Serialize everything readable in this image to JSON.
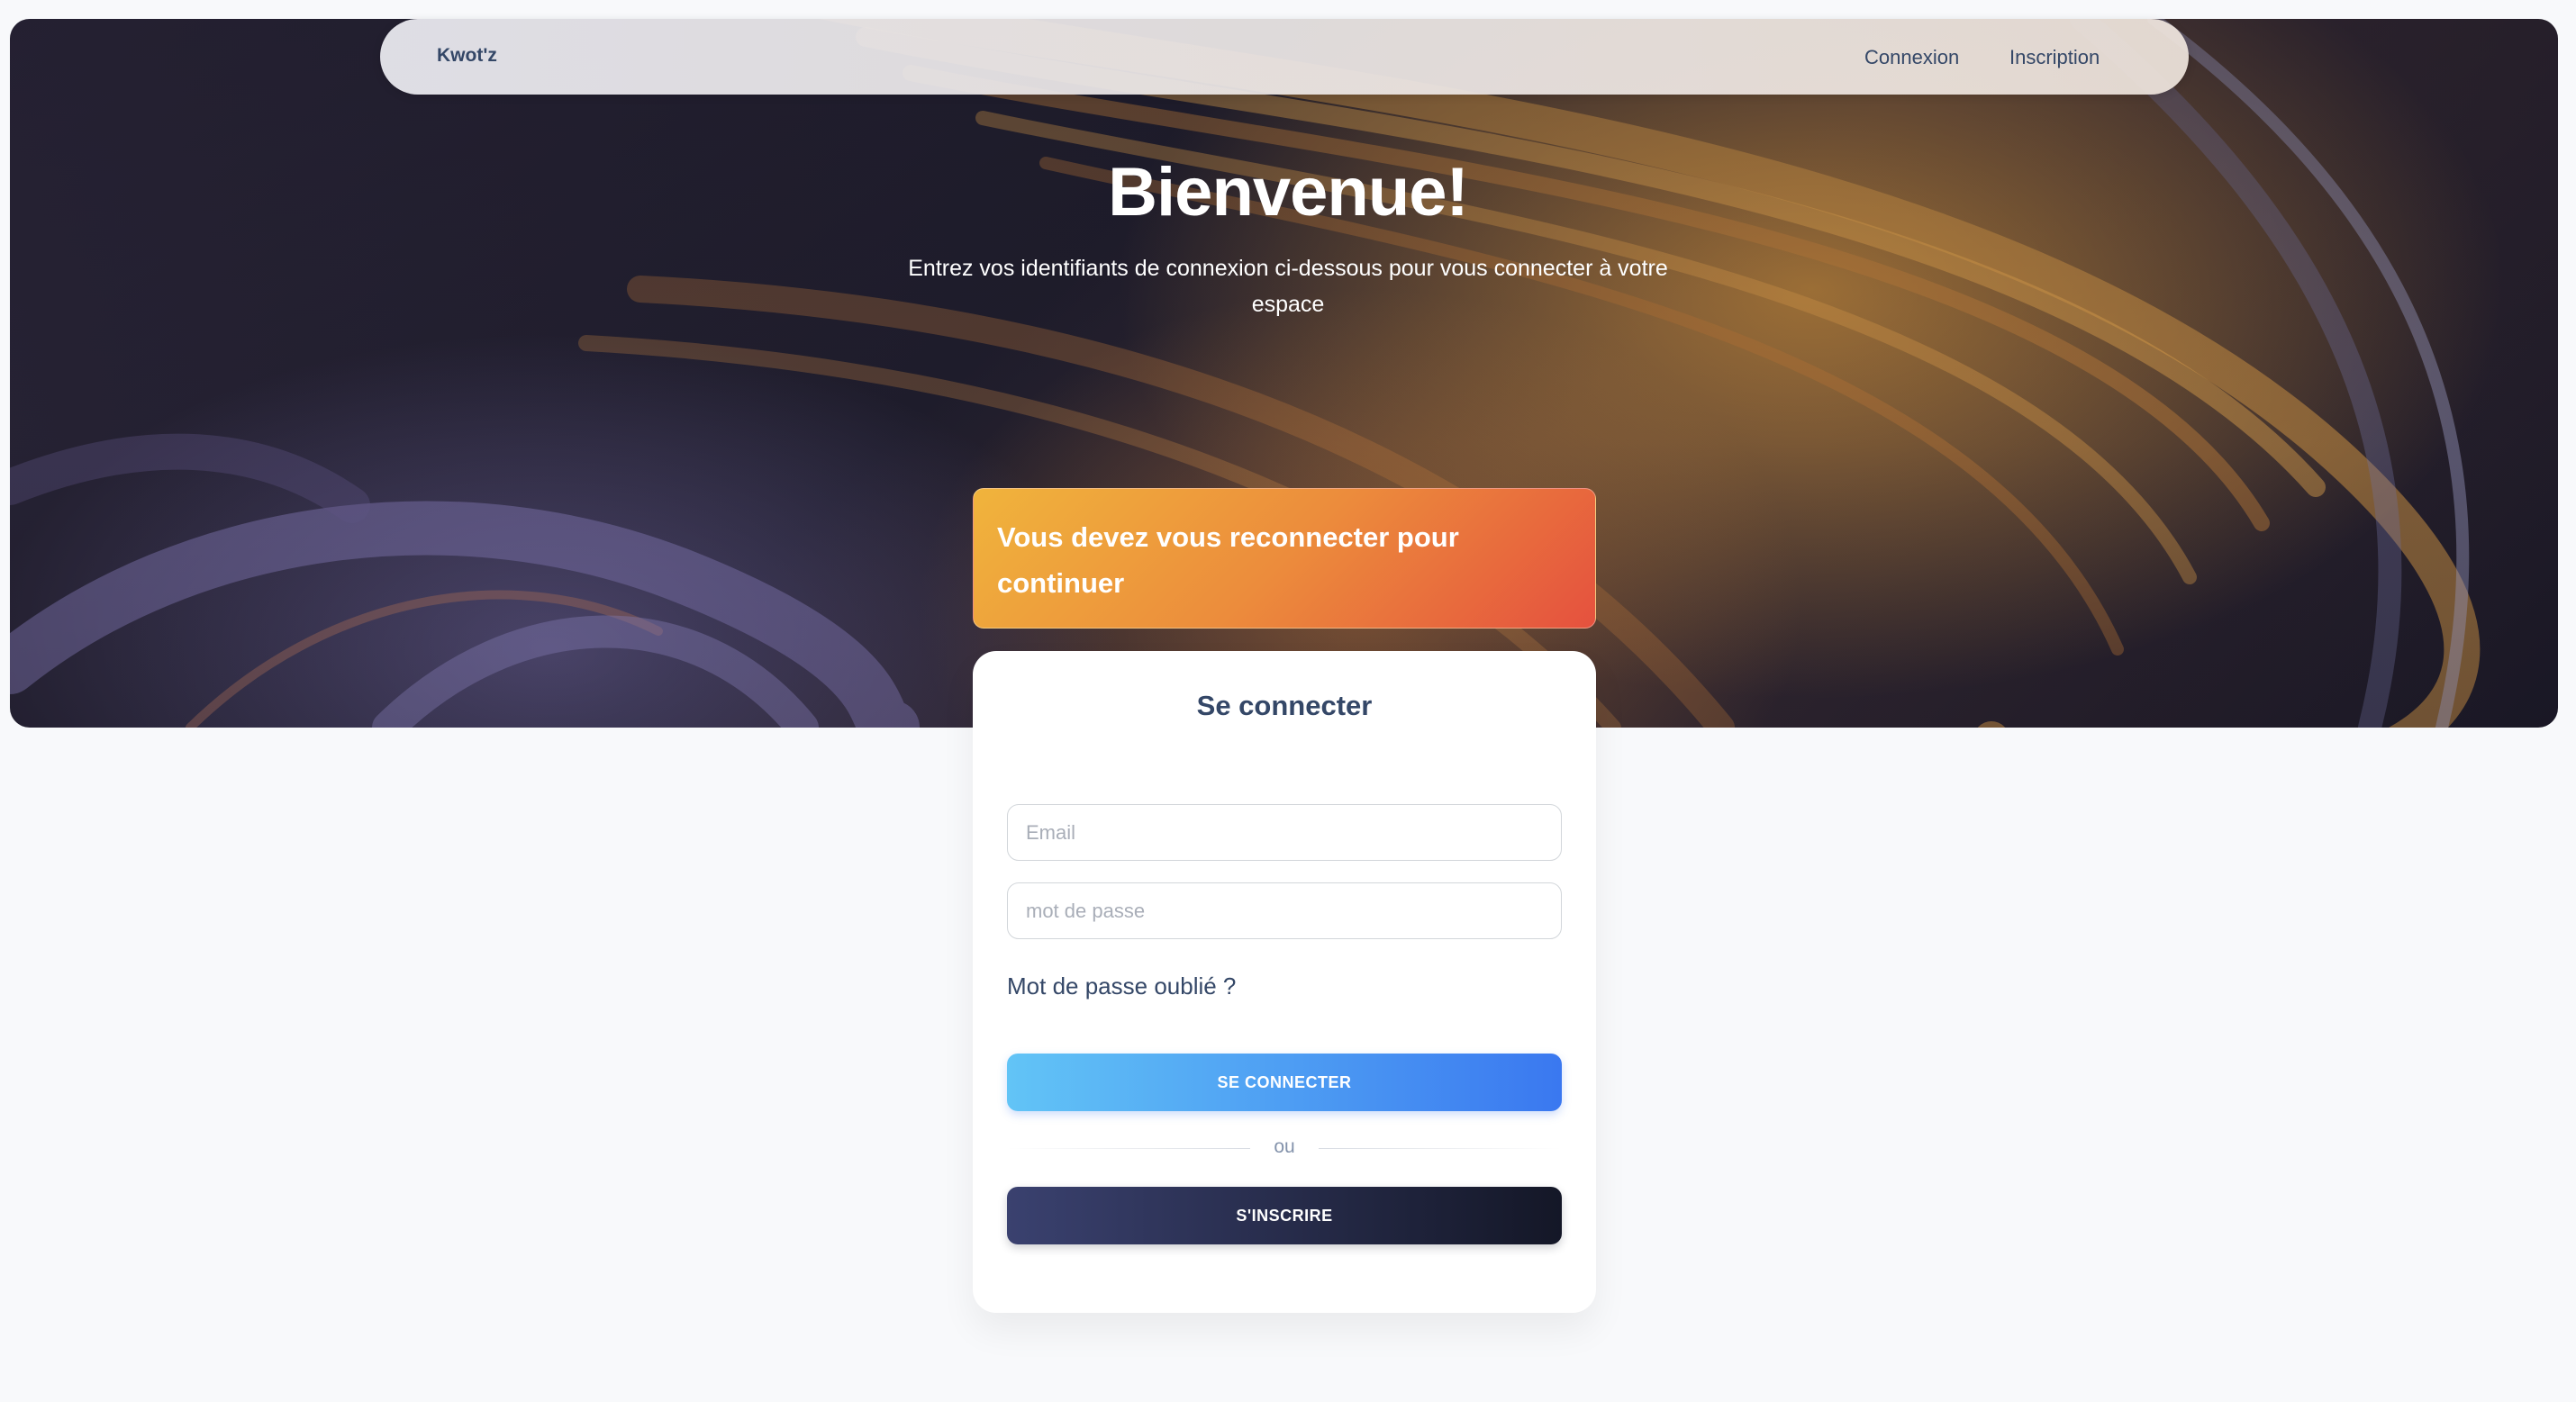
{
  "navbar": {
    "brand": "Kwot'z",
    "links": [
      {
        "label": "Connexion"
      },
      {
        "label": "Inscription"
      }
    ]
  },
  "hero": {
    "title": "Bienvenue!",
    "subtitle": "Entrez vos identifiants de connexion ci-dessous pour vous connecter à votre espace"
  },
  "alert": {
    "message": "Vous devez vous reconnecter pour continuer"
  },
  "login_card": {
    "title": "Se connecter",
    "email_placeholder": "Email",
    "password_placeholder": "mot de passe",
    "forgot_password": "Mot de passe oublié ?",
    "submit_label": "SE CONNECTER",
    "divider": "ou",
    "signup_label": "S'INSCRIRE"
  },
  "colors": {
    "primary_gradient": [
      "#62c4f6",
      "#3a78f0"
    ],
    "dark_gradient": [
      "#3a416f",
      "#141727"
    ],
    "alert_gradient": [
      "#f0b43c",
      "#e5513e"
    ],
    "text": "#344767",
    "background": "#f8f9fb"
  }
}
